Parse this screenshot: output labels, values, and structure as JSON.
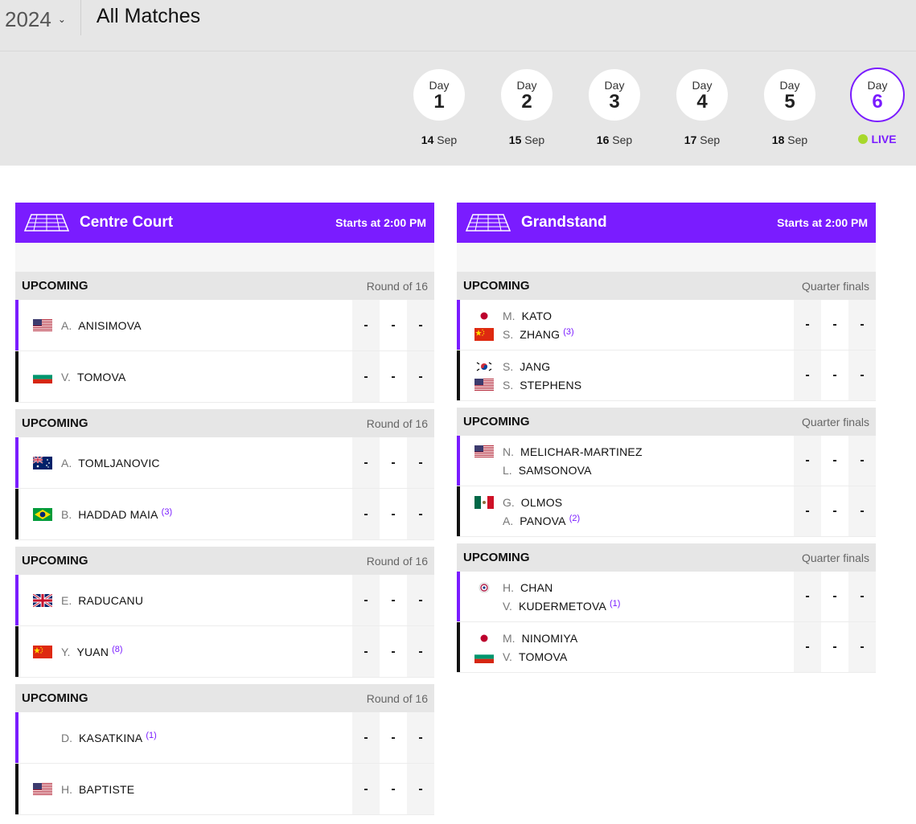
{
  "header": {
    "year": "2024",
    "title": "All Matches"
  },
  "days": [
    {
      "label": "Day",
      "num": "1",
      "date_day": "14",
      "date_month": "Sep"
    },
    {
      "label": "Day",
      "num": "2",
      "date_day": "15",
      "date_month": "Sep"
    },
    {
      "label": "Day",
      "num": "3",
      "date_day": "16",
      "date_month": "Sep"
    },
    {
      "label": "Day",
      "num": "4",
      "date_day": "17",
      "date_month": "Sep"
    },
    {
      "label": "Day",
      "num": "5",
      "date_day": "18",
      "date_month": "Sep"
    },
    {
      "label": "Day",
      "num": "6",
      "live": "LIVE"
    }
  ],
  "courts": [
    {
      "name": "Centre Court",
      "starts": "Starts at 2:00 PM",
      "matches": [
        {
          "status": "UPCOMING",
          "round": "Round of 16",
          "rows": [
            {
              "players": [
                {
                  "flag": "usa",
                  "ini": "A.",
                  "name": "ANISIMOVA",
                  "seed": ""
                }
              ],
              "scores": [
                "-",
                "-",
                "-"
              ]
            },
            {
              "players": [
                {
                  "flag": "bulgaria",
                  "ini": "V.",
                  "name": "TOMOVA",
                  "seed": ""
                }
              ],
              "scores": [
                "-",
                "-",
                "-"
              ]
            }
          ]
        },
        {
          "status": "UPCOMING",
          "round": "Round of 16",
          "rows": [
            {
              "players": [
                {
                  "flag": "australia",
                  "ini": "A.",
                  "name": "TOMLJANOVIC",
                  "seed": ""
                }
              ],
              "scores": [
                "-",
                "-",
                "-"
              ]
            },
            {
              "players": [
                {
                  "flag": "brazil",
                  "ini": "B.",
                  "name": "HADDAD MAIA",
                  "seed": "(3)"
                }
              ],
              "scores": [
                "-",
                "-",
                "-"
              ]
            }
          ]
        },
        {
          "status": "UPCOMING",
          "round": "Round of 16",
          "rows": [
            {
              "players": [
                {
                  "flag": "uk",
                  "ini": "E.",
                  "name": "RADUCANU",
                  "seed": ""
                }
              ],
              "scores": [
                "-",
                "-",
                "-"
              ]
            },
            {
              "players": [
                {
                  "flag": "china",
                  "ini": "Y.",
                  "name": "YUAN",
                  "seed": "(8)"
                }
              ],
              "scores": [
                "-",
                "-",
                "-"
              ]
            }
          ]
        },
        {
          "status": "UPCOMING",
          "round": "Round of 16",
          "rows": [
            {
              "players": [
                {
                  "flag": "none",
                  "ini": "D.",
                  "name": "KASATKINA",
                  "seed": "(1)"
                }
              ],
              "scores": [
                "-",
                "-",
                "-"
              ]
            },
            {
              "players": [
                {
                  "flag": "usa",
                  "ini": "H.",
                  "name": "BAPTISTE",
                  "seed": ""
                }
              ],
              "scores": [
                "-",
                "-",
                "-"
              ]
            }
          ]
        }
      ]
    },
    {
      "name": "Grandstand",
      "starts": "Starts at 2:00 PM",
      "matches": [
        {
          "status": "UPCOMING",
          "round": "Quarter finals",
          "rows": [
            {
              "players": [
                {
                  "flag": "japan",
                  "ini": "M.",
                  "name": "KATO",
                  "seed": ""
                },
                {
                  "flag": "china",
                  "ini": "S.",
                  "name": "ZHANG",
                  "seed": "(3)"
                }
              ],
              "scores": [
                "-",
                "-",
                "-"
              ]
            },
            {
              "players": [
                {
                  "flag": "korea",
                  "ini": "S.",
                  "name": "JANG",
                  "seed": ""
                },
                {
                  "flag": "usa",
                  "ini": "S.",
                  "name": "STEPHENS",
                  "seed": ""
                }
              ],
              "scores": [
                "-",
                "-",
                "-"
              ]
            }
          ]
        },
        {
          "status": "UPCOMING",
          "round": "Quarter finals",
          "rows": [
            {
              "players": [
                {
                  "flag": "usa",
                  "ini": "N.",
                  "name": "MELICHAR-MARTINEZ",
                  "seed": ""
                },
                {
                  "flag": "none",
                  "ini": "L.",
                  "name": "SAMSONOVA",
                  "seed": ""
                }
              ],
              "scores": [
                "-",
                "-",
                "-"
              ]
            },
            {
              "players": [
                {
                  "flag": "mexico",
                  "ini": "G.",
                  "name": "OLMOS",
                  "seed": ""
                },
                {
                  "flag": "none",
                  "ini": "A.",
                  "name": "PANOVA",
                  "seed": "(2)"
                }
              ],
              "scores": [
                "-",
                "-",
                "-"
              ]
            }
          ]
        },
        {
          "status": "UPCOMING",
          "round": "Quarter finals",
          "rows": [
            {
              "players": [
                {
                  "flag": "taipei",
                  "ini": "H.",
                  "name": "CHAN",
                  "seed": ""
                },
                {
                  "flag": "none",
                  "ini": "V.",
                  "name": "KUDERMETOVA",
                  "seed": "(1)"
                }
              ],
              "scores": [
                "-",
                "-",
                "-"
              ]
            },
            {
              "players": [
                {
                  "flag": "japan",
                  "ini": "M.",
                  "name": "NINOMIYA",
                  "seed": ""
                },
                {
                  "flag": "bulgaria",
                  "ini": "V.",
                  "name": "TOMOVA",
                  "seed": ""
                }
              ],
              "scores": [
                "-",
                "-",
                "-"
              ]
            }
          ]
        }
      ]
    }
  ],
  "colors": {
    "accent": "#7a1cff",
    "live_ball": "#a7d82b"
  }
}
